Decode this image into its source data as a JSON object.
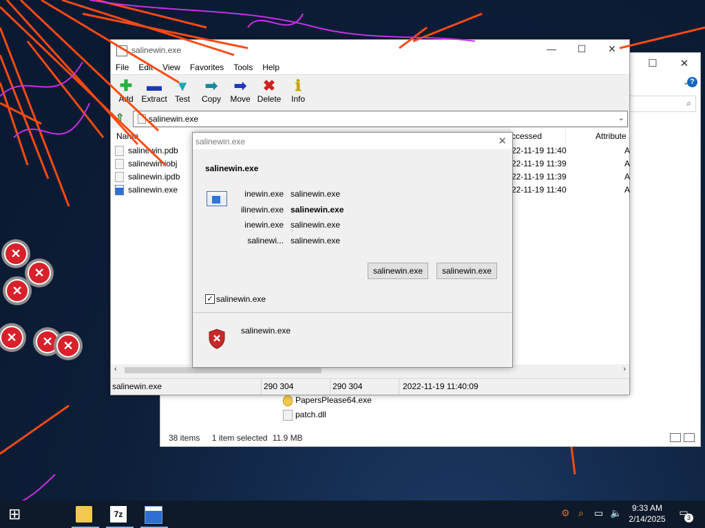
{
  "explorer": {
    "files": [
      {
        "name": "PapersPlease64.exe",
        "type": "exe"
      },
      {
        "name": "patch.dll",
        "type": "dll"
      }
    ],
    "status": {
      "items": "38 items",
      "selected": "1 item selected",
      "size": "11.9 MB"
    }
  },
  "zip": {
    "title": "salinewin.exe",
    "menu": [
      "File",
      "Edit",
      "View",
      "Favorites",
      "Tools",
      "Help"
    ],
    "toolbar": [
      {
        "label": "Add",
        "icon": "plus-icon",
        "color": "#21b33b"
      },
      {
        "label": "Extract",
        "icon": "minus-icon",
        "color": "#1f37b8"
      },
      {
        "label": "Test",
        "icon": "check-icon",
        "color": "#19a7b8"
      },
      {
        "label": "Copy",
        "icon": "arrow-right-icon",
        "color": "#1a8a9a"
      },
      {
        "label": "Move",
        "icon": "arrow-right-icon",
        "color": "#1f37b8"
      },
      {
        "label": "Delete",
        "icon": "delete-x-icon",
        "color": "#d32020"
      },
      {
        "label": "Info",
        "icon": "info-icon",
        "color": "#c7a600"
      }
    ],
    "address": "salinewin.exe",
    "columns": {
      "name": "Name",
      "accessed": "ccessed",
      "attributes": "Attribute"
    },
    "rows": [
      {
        "name": "salinewin.pdb",
        "accessed": "22-11-19 11:40",
        "attr": "A"
      },
      {
        "name": "salinewin.iobj",
        "accessed": "22-11-19 11:39",
        "attr": "A"
      },
      {
        "name": "salinewin.ipdb",
        "accessed": "22-11-19 11:39",
        "attr": "A"
      },
      {
        "name": "salinewin.exe",
        "accessed": "22-11-19 11:40",
        "attr": "A"
      }
    ],
    "statusbar": [
      "salinewin.exe",
      "290 304",
      "290 304",
      "2022-11-19 11:40:09"
    ]
  },
  "dialog": {
    "title": "salinewin.exe",
    "heading": "salinewin.exe",
    "pairs": [
      {
        "label": "inewin.exe",
        "value": "salinewin.exe",
        "bold": false
      },
      {
        "label": "ilinewin.exe",
        "value": "salinewin.exe",
        "bold": true
      },
      {
        "label": "inewin.exe",
        "value": "salinewin.exe",
        "bold": false
      },
      {
        "label": "salinewi...",
        "value": "salinewin.exe",
        "bold": false
      }
    ],
    "button1": "salinewin.exe",
    "button2": "salinewin.exe",
    "checkbox_label": "salinewin.exe",
    "checkbox_checked": true,
    "note": "salinewin.exe"
  },
  "taskbar": {
    "time": "9:33 AM",
    "date": "2/14/2025",
    "notification_count": "3",
    "zip_label": "7z"
  }
}
